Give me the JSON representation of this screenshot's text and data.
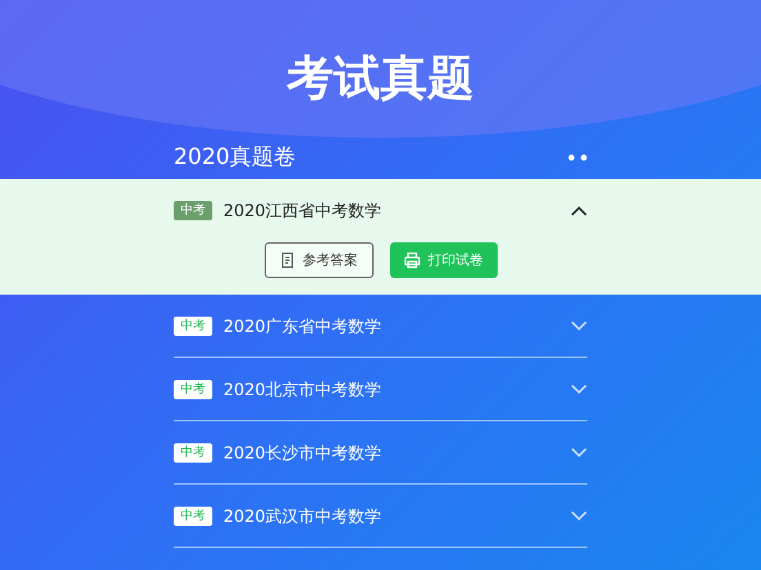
{
  "header": {
    "title": "考试真题"
  },
  "section": {
    "title": "2020真题卷"
  },
  "papers": [
    {
      "tag": "中考",
      "title": "2020江西省中考数学",
      "expanded": true,
      "actions": [
        {
          "kind": "answer",
          "label": "参考答案"
        },
        {
          "kind": "print",
          "label": "打印试卷"
        }
      ]
    },
    {
      "tag": "中考",
      "title": "2020广东省中考数学",
      "expanded": false
    },
    {
      "tag": "中考",
      "title": "2020北京市中考数学",
      "expanded": false
    },
    {
      "tag": "中考",
      "title": "2020长沙市中考数学",
      "expanded": false
    },
    {
      "tag": "中考",
      "title": "2020武汉市中考数学",
      "expanded": false
    }
  ]
}
